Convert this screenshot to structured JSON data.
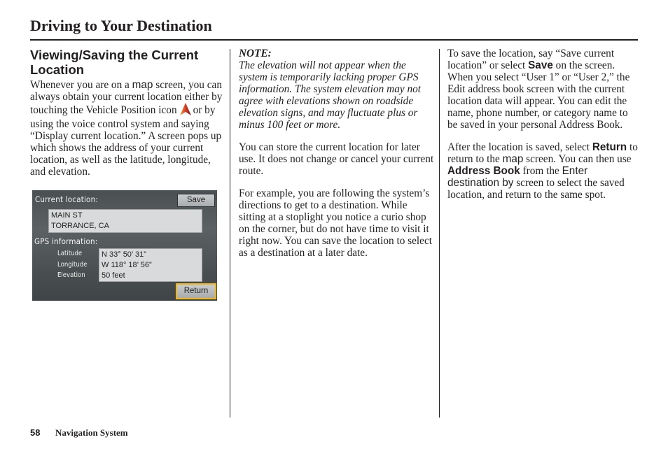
{
  "page": {
    "title": "Driving to Your Destination",
    "footer": {
      "page_number": "58",
      "section": "Navigation System"
    }
  },
  "col1": {
    "section_title": "Viewing/Saving the Current Location",
    "intro": {
      "p1": "Whenever you are on a ",
      "map": "map",
      "p2": " screen, you can always obtain your current location either by touching the Vehicle Position icon",
      "p3": "or by using the voice control system and saying “Display current location.” A screen pops up which shows the address of your current location, as well as the latitude, longitude, and elevation."
    },
    "icon": "vehicle-position-arrow",
    "screen": {
      "current_location_label": "Current location:",
      "address_line1": "MAIN ST",
      "address_line2": "TORRANCE, CA",
      "gps_label": "GPS information:",
      "latitude_label": "Latitude",
      "longitude_label": "Longitude",
      "elevation_label": "Elevation",
      "latitude": "N 33° 50’ 31”",
      "longitude": "W 118° 18’ 56”",
      "elevation": "50 feet",
      "save_button": "Save",
      "return_button": "Return",
      "highlight_color": "#f1b719"
    }
  },
  "col2": {
    "note_label": "NOTE:",
    "note_body": "The elevation will not appear when the system is temporarily lacking proper GPS information. The system elevation may not agree with elevations shown on roadside elevation signs, and may fluctuate plus or minus 100 feet or more.",
    "p1": "You can store the current location for later use. It does not change or cancel your current route.",
    "p2": "For example, you are following the system’s directions to get to a destination. While sitting at a stoplight you notice a curio shop on the corner, but do not have time to visit it right now. You can save the location to select as a destination at a later date."
  },
  "col3": {
    "p1": {
      "a": "To save the location, say “Save current location” or select ",
      "save": "Save",
      "b": " on the screen. When you select “User 1” or “User 2,” the Edit address book screen with the current location data will appear. You can edit the name, phone number, or category name to be saved in your personal Address Book."
    },
    "p2": {
      "a": "After the location is saved, select ",
      "return": "Return",
      "b": " to return to the ",
      "map": "map",
      "c": " screen. You can then use ",
      "address_book": "Address Book",
      "d": " from the ",
      "enter_dest": "Enter destination by",
      "e": " screen to select the saved location, and return to the same spot."
    }
  }
}
